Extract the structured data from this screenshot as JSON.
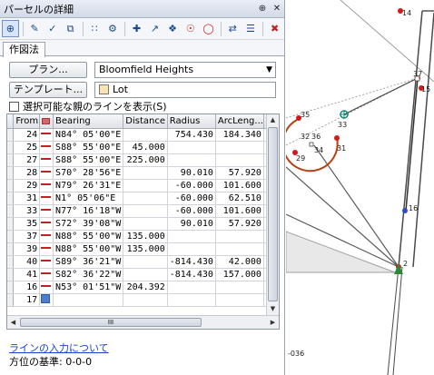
{
  "window": {
    "title": "パーセルの詳細",
    "pin_glyph": "⊕",
    "close_glyph": "✕"
  },
  "toolbar": {
    "tools": [
      "select-tool",
      "edit-tool",
      "check-tool",
      "copy-tool",
      "grid-tool",
      "settings-tool",
      "add-point-tool",
      "line-tool",
      "point-tool",
      "circle-tool",
      "circle2-tool",
      "reverse-tool",
      "list-tool",
      "delete-tool"
    ]
  },
  "tabs": [
    "作図法"
  ],
  "plan_button": "プラン...",
  "plan_value": "Bloomfield Heights",
  "template_button": "テンプレート...",
  "template_value": "Lot",
  "template_color": "#f7e4b0",
  "show_lines_checkbox": "選択可能な親のラインを表示(S)",
  "grid": {
    "headers": [
      "From",
      "",
      "Bearing",
      "Distance",
      "Radius",
      "ArcLeng...",
      "To"
    ],
    "rows": [
      {
        "from": "24",
        "bearing": "N84° 05'00\"E",
        "distance": "",
        "radius": "754.430",
        "arc": "184.340"
      },
      {
        "from": "25",
        "bearing": "S88° 55'00\"E",
        "distance": "45.000",
        "radius": "",
        "arc": ""
      },
      {
        "from": "27",
        "bearing": "S88° 55'00\"E",
        "distance": "225.000",
        "radius": "",
        "arc": ""
      },
      {
        "from": "28",
        "bearing": "S70° 28'56\"E",
        "distance": "",
        "radius": "90.010",
        "arc": "57.920"
      },
      {
        "from": "29",
        "bearing": "N79° 26'31\"E",
        "distance": "",
        "radius": "-60.000",
        "arc": "101.600"
      },
      {
        "from": "31",
        "bearing": "N1° 05'06\"E",
        "distance": "",
        "radius": "-60.000",
        "arc": "62.510"
      },
      {
        "from": "33",
        "bearing": "N77° 16'18\"W",
        "distance": "",
        "radius": "-60.000",
        "arc": "101.600"
      },
      {
        "from": "35",
        "bearing": "S72° 39'08\"W",
        "distance": "",
        "radius": "90.010",
        "arc": "57.920"
      },
      {
        "from": "37",
        "bearing": "N88° 55'00\"W",
        "distance": "135.000",
        "radius": "",
        "arc": ""
      },
      {
        "from": "39",
        "bearing": "N88° 55'00\"W",
        "distance": "135.000",
        "radius": "",
        "arc": ""
      },
      {
        "from": "40",
        "bearing": "S89° 36'21\"W",
        "distance": "",
        "radius": "-814.430",
        "arc": "42.000"
      },
      {
        "from": "41",
        "bearing": "S82° 36'22\"W",
        "distance": "",
        "radius": "-814.430",
        "arc": "157.000"
      },
      {
        "from": "16",
        "bearing": "N53° 01'51\"W",
        "distance": "204.392",
        "radius": "",
        "arc": ""
      },
      {
        "from": "17",
        "bearing": "",
        "distance": "",
        "radius": "",
        "arc": ""
      }
    ],
    "scroll_grip": "III"
  },
  "help_link": "ラインの入力について",
  "azimuth_basis": "方位の基準:  0-0-0",
  "map": {
    "labels": [
      "14",
      "37",
      "15",
      "35",
      "33",
      "32",
      "36",
      "34",
      "29",
      "31",
      "16",
      "2",
      "-036"
    ]
  }
}
